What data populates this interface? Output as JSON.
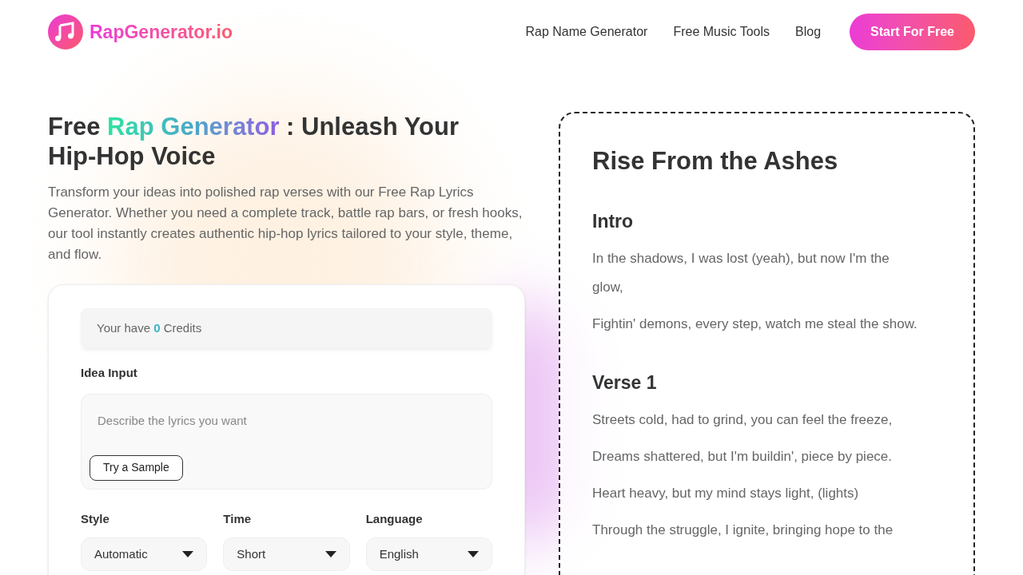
{
  "header": {
    "logo_text": "RapGenerator.io",
    "nav": [
      {
        "label": "Rap Name Generator"
      },
      {
        "label": "Free Music Tools"
      },
      {
        "label": "Blog"
      }
    ],
    "cta": "Start For Free"
  },
  "hero": {
    "title_start": "Free",
    "title_highlight": "Rap Generator",
    "title_end": ": Unleash Your Hip-Hop Voice",
    "description": "Transform your ideas into polished rap verses with our Free Rap Lyrics Generator. Whether you need a complete track, battle rap bars, or fresh hooks, our tool instantly creates authentic hip-hop lyrics tailored to your style, theme, and flow."
  },
  "form": {
    "credits": {
      "before": "Your have",
      "count": "0",
      "after": "Credits"
    },
    "idea_label": "Idea Input",
    "idea_placeholder": "Describe the lyrics you want",
    "sample_button": "Try a Sample",
    "selects": [
      {
        "label": "Style",
        "value": "Automatic"
      },
      {
        "label": "Time",
        "value": "Short"
      },
      {
        "label": "Language",
        "value": "English"
      }
    ]
  },
  "lyrics": {
    "title": "Rise From the Ashes",
    "sections": [
      {
        "heading": "Intro",
        "lines": [
          "In the shadows, I was lost (yeah), but now I'm the glow,",
          "Fightin' demons, every step, watch me steal the show."
        ]
      },
      {
        "heading": "Verse 1",
        "lines": [
          "Streets cold, had to grind, you can feel the freeze,",
          "Dreams shattered, but I'm buildin', piece by piece.",
          "Heart heavy, but my mind stays light, (lights)",
          "Through the struggle, I ignite, bringing hope to the"
        ]
      }
    ]
  }
}
